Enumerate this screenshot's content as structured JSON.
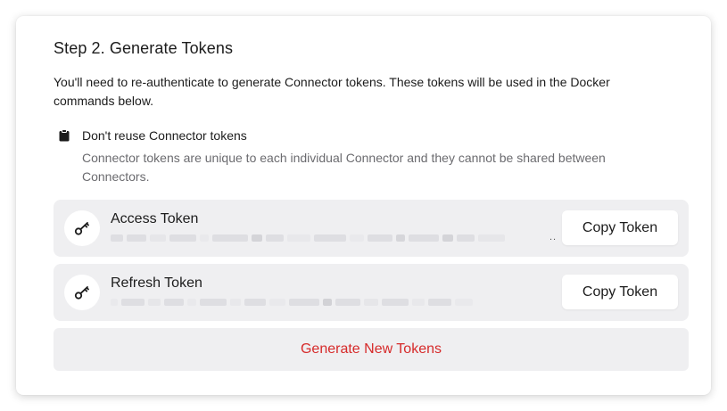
{
  "step": {
    "title": "Step 2. Generate Tokens",
    "intro": "You'll need to re-authenticate to generate Connector tokens. These tokens will be used in the Docker commands below."
  },
  "notice": {
    "icon": "clipboard-icon",
    "title": "Don't reuse Connector tokens",
    "text": "Connector tokens are unique to each individual Connector and they cannot be shared between Connectors."
  },
  "tokens": [
    {
      "label": "Access Token",
      "icon": "key-icon",
      "value_redacted": true,
      "truncation": "..",
      "copy_label": "Copy Token"
    },
    {
      "label": "Refresh Token",
      "icon": "key-icon",
      "value_redacted": true,
      "copy_label": "Copy Token"
    }
  ],
  "generate_button": {
    "label": "Generate New Tokens",
    "color": "#d62a2a"
  },
  "colors": {
    "row_background": "#efeff1",
    "muted_text": "#6b6b6f"
  }
}
